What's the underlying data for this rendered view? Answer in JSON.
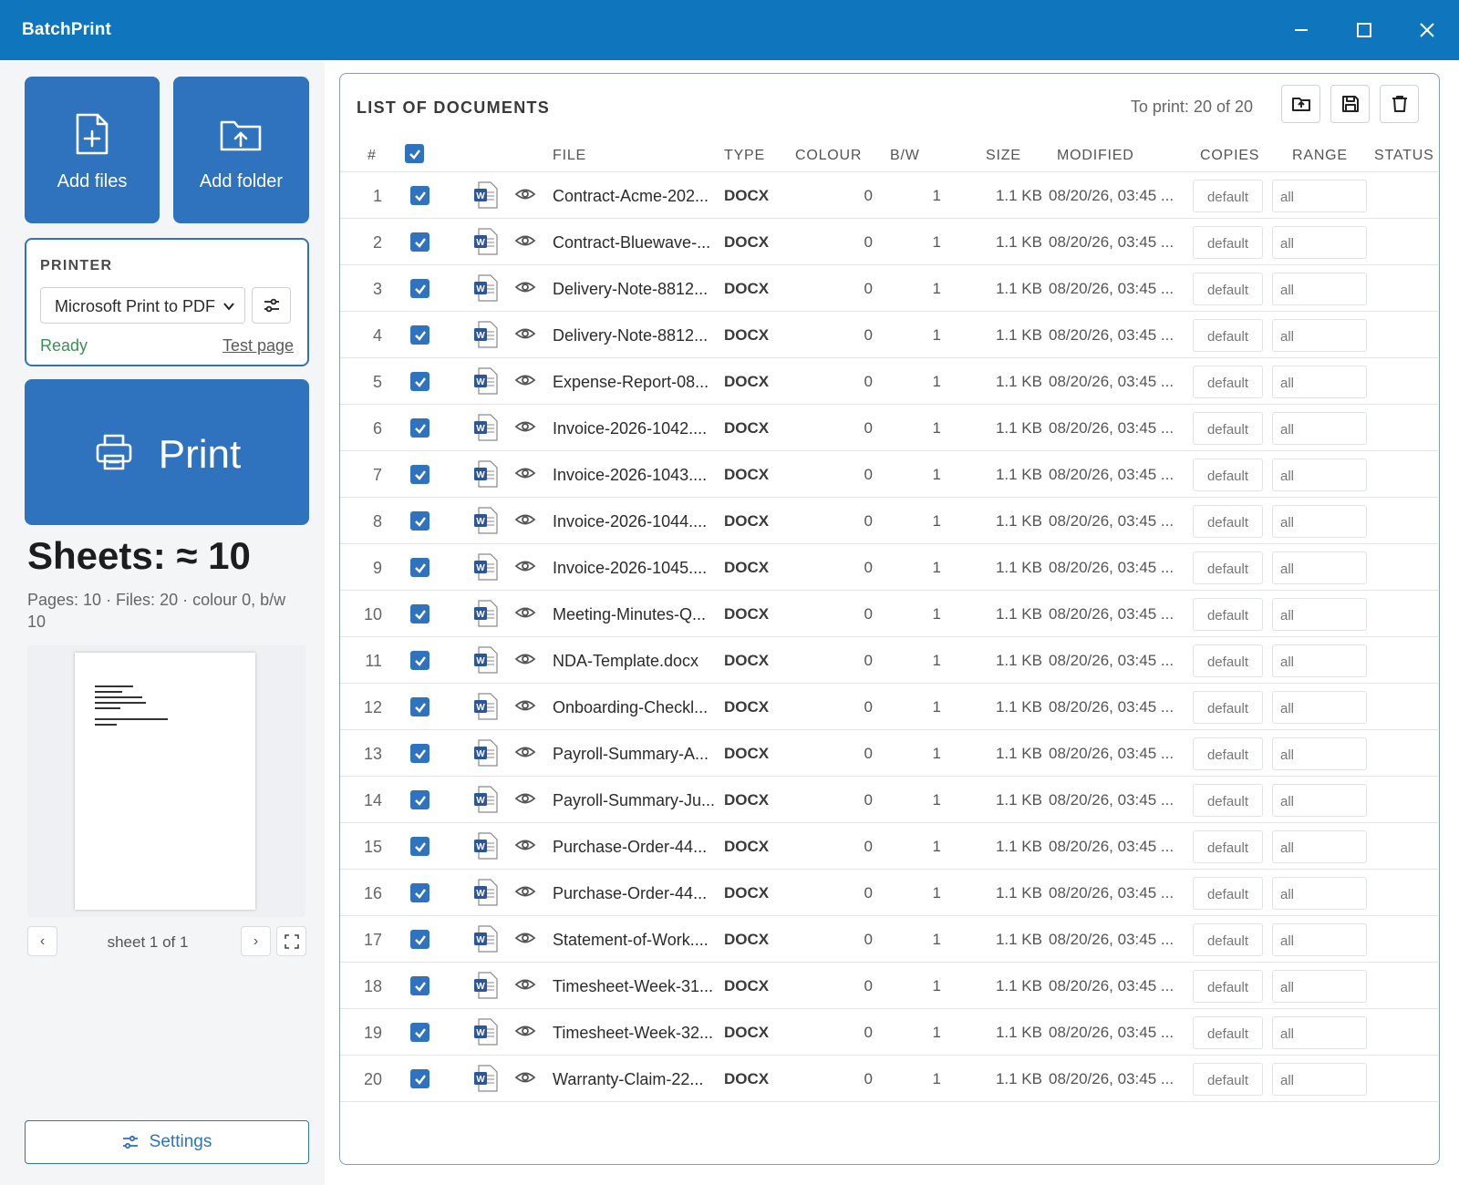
{
  "app": {
    "title": "BatchPrint"
  },
  "sidebar": {
    "add_files": "Add files",
    "add_folder": "Add folder",
    "printer": {
      "heading": "PRINTER",
      "selected": "Microsoft Print to PDF",
      "status": "Ready",
      "test_page": "Test page"
    },
    "print_label": "Print",
    "sheets": "Sheets: ≈ 10",
    "summary": "Pages: 10 · Files: 20 · colour 0, b/w 10",
    "preview": {
      "prev": "‹",
      "next": "›",
      "counter": "sheet 1 of 1"
    },
    "settings": "Settings"
  },
  "main": {
    "title": "LIST OF DOCUMENTS",
    "to_print": "To print: 20 of 20",
    "columns": {
      "num": "#",
      "file": "FILE",
      "type": "TYPE",
      "colour": "COLOUR",
      "bw": "B/W",
      "size": "SIZE",
      "modified": "MODIFIED",
      "copies": "COPIES",
      "range": "RANGE",
      "status": "STATUS"
    },
    "rows": [
      {
        "num": "1",
        "file": "Contract-Acme-202...",
        "type": "DOCX",
        "colour": "0",
        "bw": "1",
        "size": "1.1 KB",
        "modified": "08/20/26, 03:45 ...",
        "copies": "default",
        "range": "all",
        "checked": true
      },
      {
        "num": "2",
        "file": "Contract-Bluewave-...",
        "type": "DOCX",
        "colour": "0",
        "bw": "1",
        "size": "1.1 KB",
        "modified": "08/20/26, 03:45 ...",
        "copies": "default",
        "range": "all",
        "checked": true
      },
      {
        "num": "3",
        "file": "Delivery-Note-8812...",
        "type": "DOCX",
        "colour": "0",
        "bw": "1",
        "size": "1.1 KB",
        "modified": "08/20/26, 03:45 ...",
        "copies": "default",
        "range": "all",
        "checked": true
      },
      {
        "num": "4",
        "file": "Delivery-Note-8812...",
        "type": "DOCX",
        "colour": "0",
        "bw": "1",
        "size": "1.1 KB",
        "modified": "08/20/26, 03:45 ...",
        "copies": "default",
        "range": "all",
        "checked": true
      },
      {
        "num": "5",
        "file": "Expense-Report-08...",
        "type": "DOCX",
        "colour": "0",
        "bw": "1",
        "size": "1.1 KB",
        "modified": "08/20/26, 03:45 ...",
        "copies": "default",
        "range": "all",
        "checked": true
      },
      {
        "num": "6",
        "file": "Invoice-2026-1042....",
        "type": "DOCX",
        "colour": "0",
        "bw": "1",
        "size": "1.1 KB",
        "modified": "08/20/26, 03:45 ...",
        "copies": "default",
        "range": "all",
        "checked": true
      },
      {
        "num": "7",
        "file": "Invoice-2026-1043....",
        "type": "DOCX",
        "colour": "0",
        "bw": "1",
        "size": "1.1 KB",
        "modified": "08/20/26, 03:45 ...",
        "copies": "default",
        "range": "all",
        "checked": true
      },
      {
        "num": "8",
        "file": "Invoice-2026-1044....",
        "type": "DOCX",
        "colour": "0",
        "bw": "1",
        "size": "1.1 KB",
        "modified": "08/20/26, 03:45 ...",
        "copies": "default",
        "range": "all",
        "checked": true
      },
      {
        "num": "9",
        "file": "Invoice-2026-1045....",
        "type": "DOCX",
        "colour": "0",
        "bw": "1",
        "size": "1.1 KB",
        "modified": "08/20/26, 03:45 ...",
        "copies": "default",
        "range": "all",
        "checked": true
      },
      {
        "num": "10",
        "file": "Meeting-Minutes-Q...",
        "type": "DOCX",
        "colour": "0",
        "bw": "1",
        "size": "1.1 KB",
        "modified": "08/20/26, 03:45 ...",
        "copies": "default",
        "range": "all",
        "checked": true
      },
      {
        "num": "11",
        "file": "NDA-Template.docx",
        "type": "DOCX",
        "colour": "0",
        "bw": "1",
        "size": "1.1 KB",
        "modified": "08/20/26, 03:45 ...",
        "copies": "default",
        "range": "all",
        "checked": true
      },
      {
        "num": "12",
        "file": "Onboarding-Checkl...",
        "type": "DOCX",
        "colour": "0",
        "bw": "1",
        "size": "1.1 KB",
        "modified": "08/20/26, 03:45 ...",
        "copies": "default",
        "range": "all",
        "checked": true
      },
      {
        "num": "13",
        "file": "Payroll-Summary-A...",
        "type": "DOCX",
        "colour": "0",
        "bw": "1",
        "size": "1.1 KB",
        "modified": "08/20/26, 03:45 ...",
        "copies": "default",
        "range": "all",
        "checked": true
      },
      {
        "num": "14",
        "file": "Payroll-Summary-Ju...",
        "type": "DOCX",
        "colour": "0",
        "bw": "1",
        "size": "1.1 KB",
        "modified": "08/20/26, 03:45 ...",
        "copies": "default",
        "range": "all",
        "checked": true
      },
      {
        "num": "15",
        "file": "Purchase-Order-44...",
        "type": "DOCX",
        "colour": "0",
        "bw": "1",
        "size": "1.1 KB",
        "modified": "08/20/26, 03:45 ...",
        "copies": "default",
        "range": "all",
        "checked": true
      },
      {
        "num": "16",
        "file": "Purchase-Order-44...",
        "type": "DOCX",
        "colour": "0",
        "bw": "1",
        "size": "1.1 KB",
        "modified": "08/20/26, 03:45 ...",
        "copies": "default",
        "range": "all",
        "checked": true
      },
      {
        "num": "17",
        "file": "Statement-of-Work....",
        "type": "DOCX",
        "colour": "0",
        "bw": "1",
        "size": "1.1 KB",
        "modified": "08/20/26, 03:45 ...",
        "copies": "default",
        "range": "all",
        "checked": true
      },
      {
        "num": "18",
        "file": "Timesheet-Week-31...",
        "type": "DOCX",
        "colour": "0",
        "bw": "1",
        "size": "1.1 KB",
        "modified": "08/20/26, 03:45 ...",
        "copies": "default",
        "range": "all",
        "checked": true
      },
      {
        "num": "19",
        "file": "Timesheet-Week-32...",
        "type": "DOCX",
        "colour": "0",
        "bw": "1",
        "size": "1.1 KB",
        "modified": "08/20/26, 03:45 ...",
        "copies": "default",
        "range": "all",
        "checked": true
      },
      {
        "num": "20",
        "file": "Warranty-Claim-22...",
        "type": "DOCX",
        "colour": "0",
        "bw": "1",
        "size": "1.1 KB",
        "modified": "08/20/26, 03:45 ...",
        "copies": "default",
        "range": "all",
        "checked": true
      }
    ]
  },
  "colors": {
    "titlebar": "#0f75bc",
    "accent": "#2f73be",
    "ready": "#3b8f57",
    "word_blue": "#2b579a"
  },
  "icons": [
    "minimize-icon",
    "maximize-icon",
    "close-icon",
    "file-plus-icon",
    "folder-upload-icon",
    "chevron-down-icon",
    "sliders-icon",
    "printer-icon",
    "fullscreen-icon",
    "folder-open-icon",
    "save-icon",
    "trash-icon",
    "word-doc-icon",
    "eye-icon",
    "checkbox-icon"
  ]
}
